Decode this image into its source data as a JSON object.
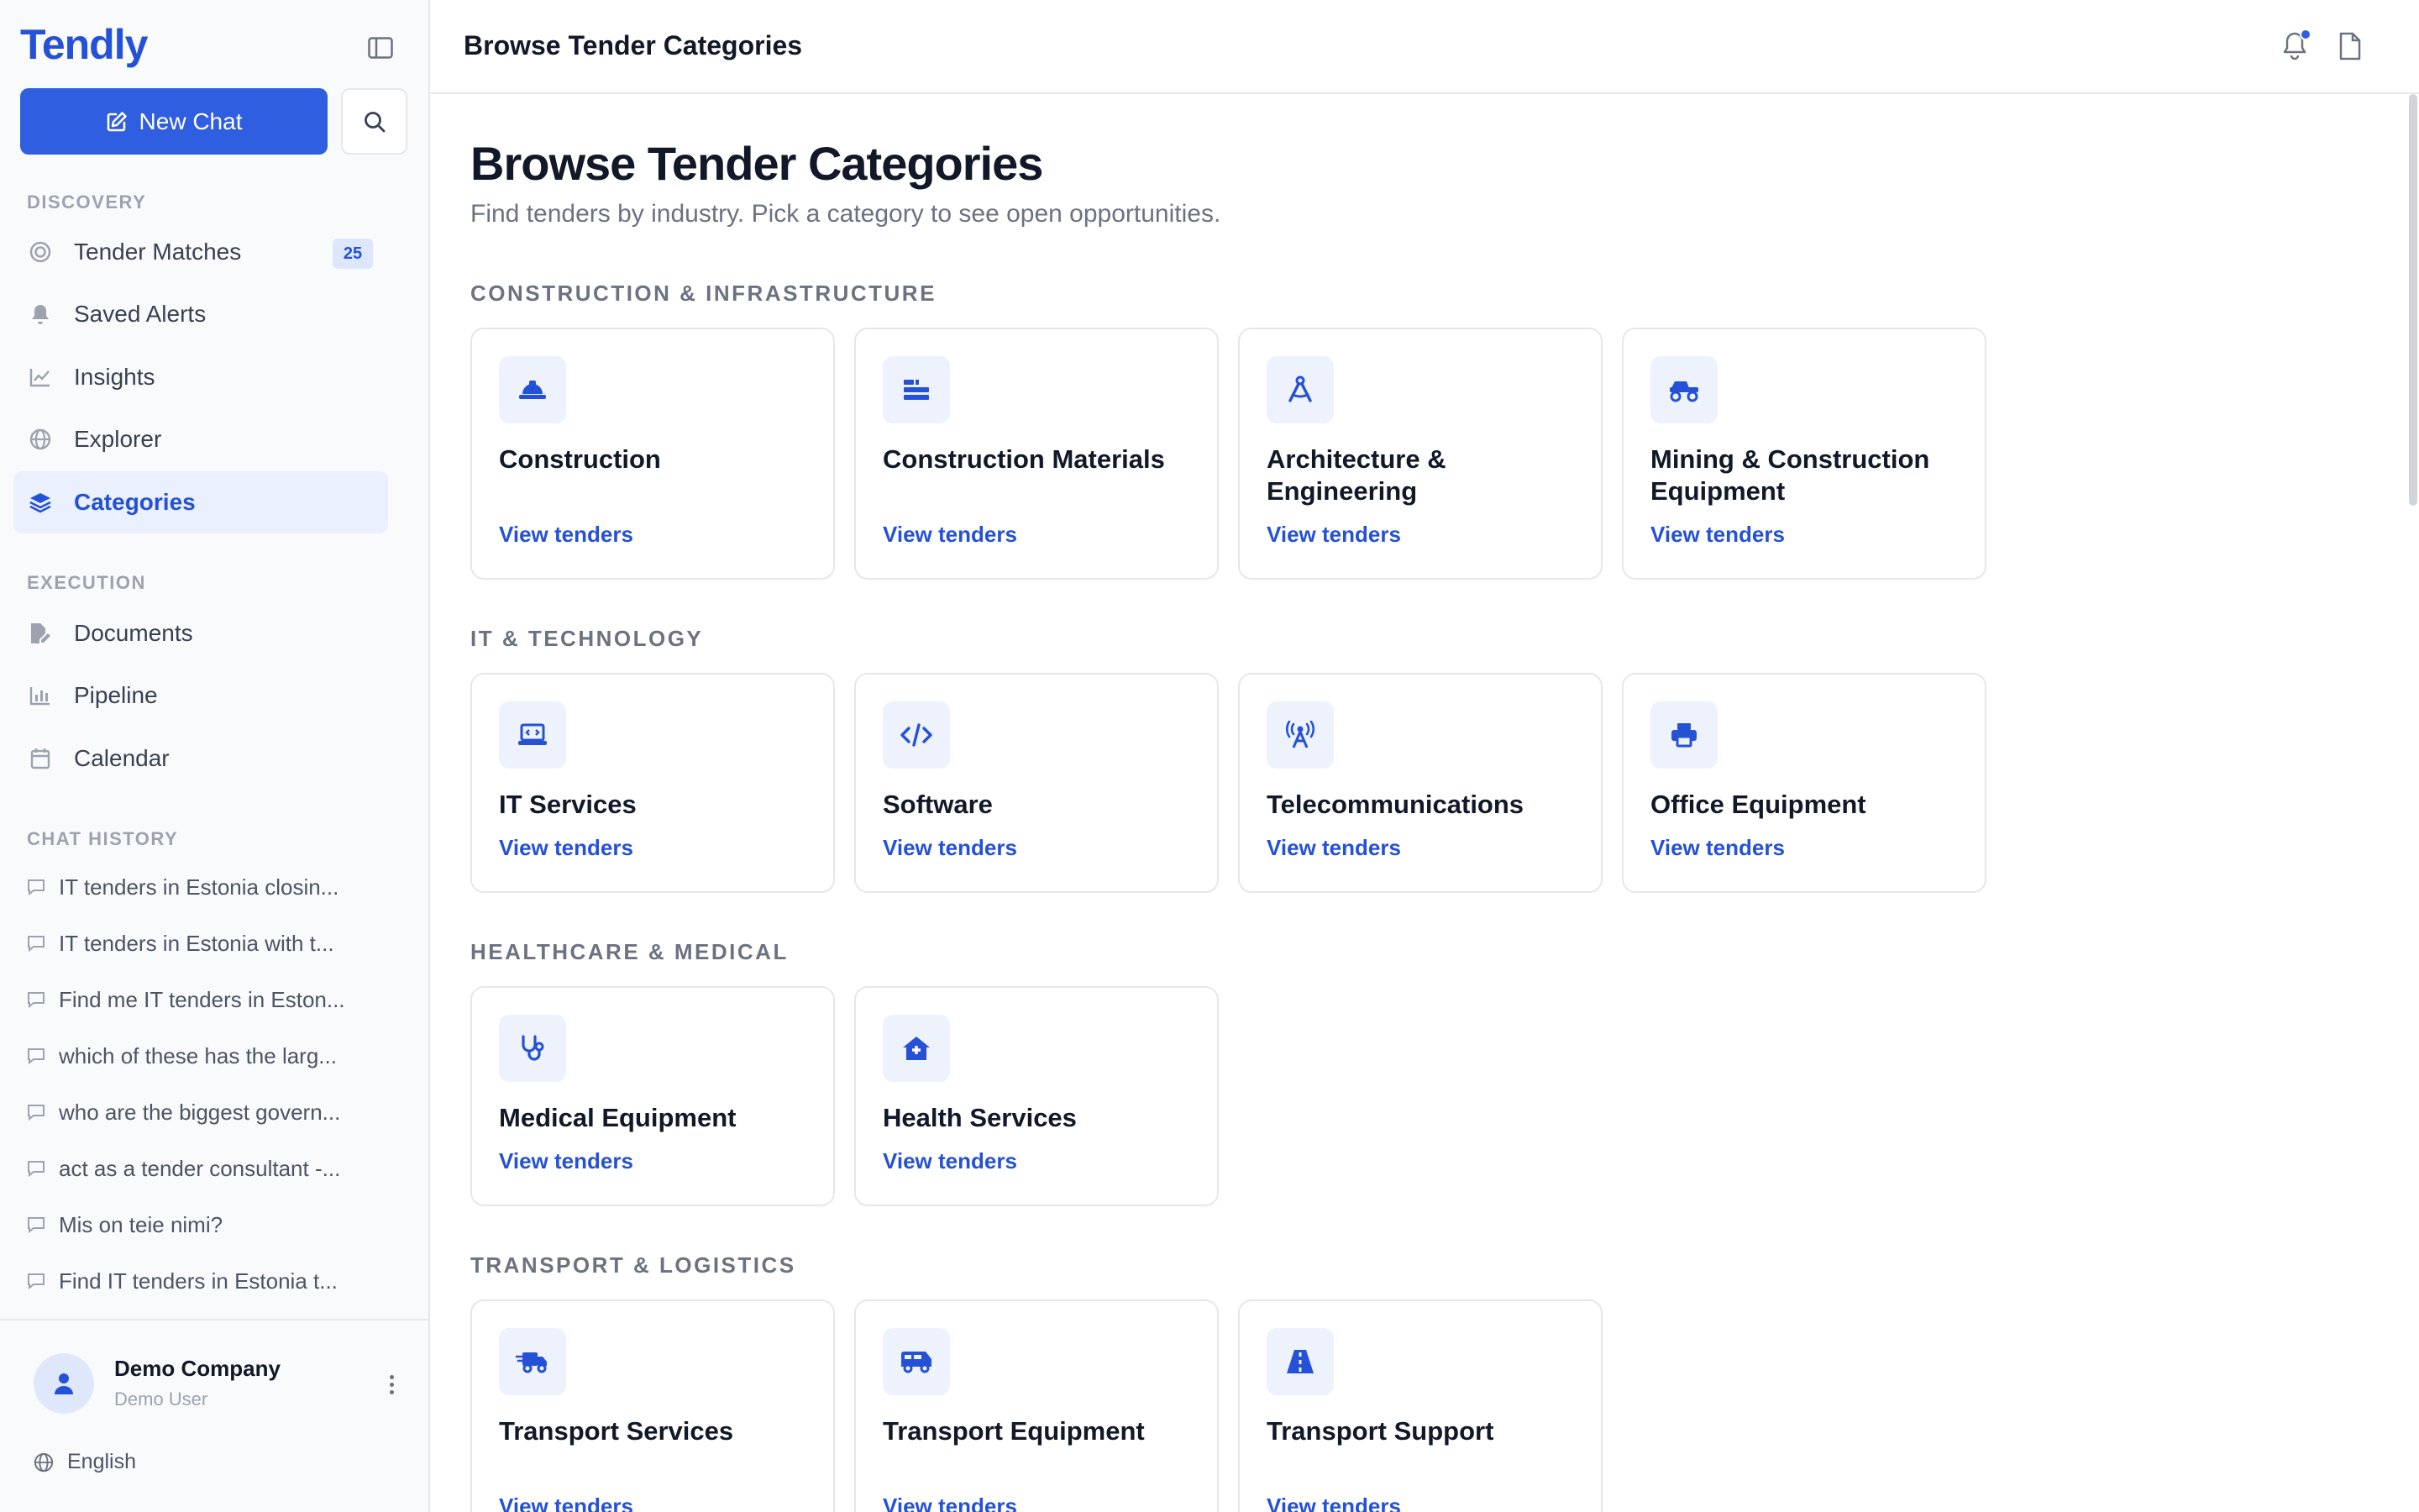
{
  "app": {
    "brand": "Tendly",
    "new_chat_label": "New Chat"
  },
  "sidebar": {
    "discovery_label": "DISCOVERY",
    "discovery": [
      {
        "label": "Tender Matches",
        "icon": "target-icon",
        "badge": "25"
      },
      {
        "label": "Saved Alerts",
        "icon": "bell-icon"
      },
      {
        "label": "Insights",
        "icon": "line-chart-icon"
      },
      {
        "label": "Explorer",
        "icon": "globe-icon"
      },
      {
        "label": "Categories",
        "icon": "layers-icon",
        "active": true
      }
    ],
    "execution_label": "EXECUTION",
    "execution": [
      {
        "label": "Documents",
        "icon": "file-edit-icon"
      },
      {
        "label": "Pipeline",
        "icon": "bar-chart-icon"
      },
      {
        "label": "Calendar",
        "icon": "calendar-icon"
      }
    ],
    "history_label": "CHAT HISTORY",
    "history": [
      "IT tenders in Estonia closin...",
      "IT tenders in Estonia with t...",
      "Find me IT tenders in Eston...",
      "which of these has the larg...",
      "who are the biggest govern...",
      "act as a tender consultant -...",
      "Mis on teie nimi?",
      "Find IT tenders in Estonia t..."
    ],
    "user": {
      "company": "Demo Company",
      "name": "Demo User"
    },
    "language": "English"
  },
  "header": {
    "title": "Browse Tender Categories"
  },
  "main": {
    "title": "Browse Tender Categories",
    "subtitle": "Find tenders by industry. Pick a category to see open opportunities.",
    "link_label": "View tenders",
    "groups": [
      {
        "title": "CONSTRUCTION & INFRASTRUCTURE",
        "items": [
          {
            "name": "Construction",
            "icon": "hard-hat-icon"
          },
          {
            "name": "Construction Materials",
            "icon": "bricks-icon"
          },
          {
            "name": "Architecture & Engineering",
            "icon": "compass-drafting-icon"
          },
          {
            "name": "Mining & Construction Equipment",
            "icon": "excavator-icon"
          }
        ]
      },
      {
        "title": "IT & TECHNOLOGY",
        "items": [
          {
            "name": "IT Services",
            "icon": "laptop-code-icon"
          },
          {
            "name": "Software",
            "icon": "code-icon"
          },
          {
            "name": "Telecommunications",
            "icon": "tower-broadcast-icon"
          },
          {
            "name": "Office Equipment",
            "icon": "printer-icon"
          }
        ]
      },
      {
        "title": "HEALTHCARE & MEDICAL",
        "items": [
          {
            "name": "Medical Equipment",
            "icon": "stethoscope-icon"
          },
          {
            "name": "Health Services",
            "icon": "house-medical-icon"
          }
        ]
      },
      {
        "title": "TRANSPORT & LOGISTICS",
        "items": [
          {
            "name": "Transport Services",
            "icon": "truck-fast-icon"
          },
          {
            "name": "Transport Equipment",
            "icon": "van-icon"
          },
          {
            "name": "Transport Support",
            "icon": "road-icon"
          }
        ]
      }
    ]
  },
  "colors": {
    "accent": "#2f5ee0",
    "accent_text": "#2451d6",
    "icon_bg": "#eef2fc"
  }
}
